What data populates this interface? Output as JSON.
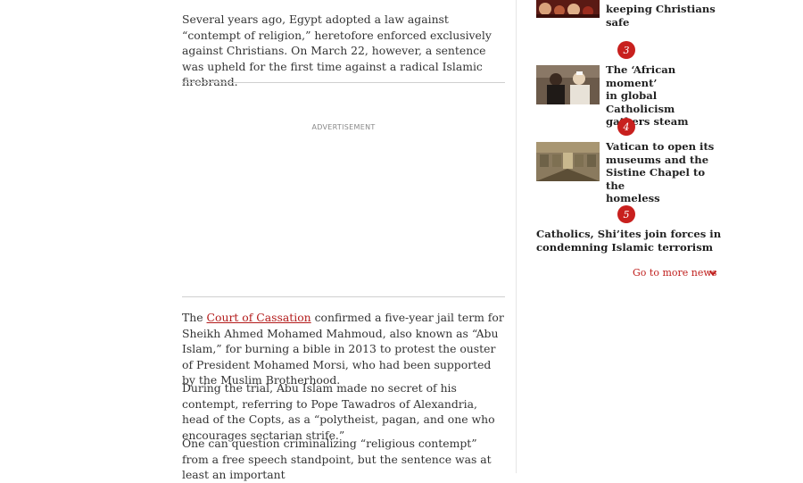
{
  "article": {
    "p1": "Several years ago, Egypt adopted a law against “contempt of religion,” heretofore enforced exclusively against Christians. On March 22, however, a sentence was upheld for the first time against a radical Islamic firebrand.",
    "ad_label": "ADVERTISEMENT",
    "p2_before": "The ",
    "p2_link": "Court of Cassation",
    "p2_after": " confirmed a five-year jail term for Sheikh Ahmed Mohamed Mahmoud, also known as “Abu Islam,” for burning a bible in 2013 to protest the ouster of President Mohamed Morsi, who had been supported by the Muslim Brotherhood.",
    "p3": "During the trial, Abu Islam made no secret of his contempt, referring to Pope Tawadros of Alexandria, head of the Copts, as a “polytheist, pagan, and one who encourages sectarian strife.”",
    "p4": "One can question criminalizing “religious contempt” from a free speech standpoint, but the sentence was at least an important"
  },
  "sidebar": {
    "items": [
      {
        "title_lines": [
          "keeping Christians",
          "safe"
        ]
      },
      {
        "number": "3",
        "title_lines": [
          "The ‘African moment’",
          "in global Catholicism",
          "gathers steam"
        ]
      },
      {
        "number": "4",
        "title_lines": [
          "Vatican to open its",
          "museums and the",
          "Sistine Chapel to the",
          "homeless"
        ]
      },
      {
        "number": "5",
        "title_lines": [
          "Catholics, Shi’ites join forces in",
          "condemning Islamic terrorism"
        ]
      }
    ],
    "more_label": "Go to more news",
    "accent_color": "#c8201e"
  }
}
